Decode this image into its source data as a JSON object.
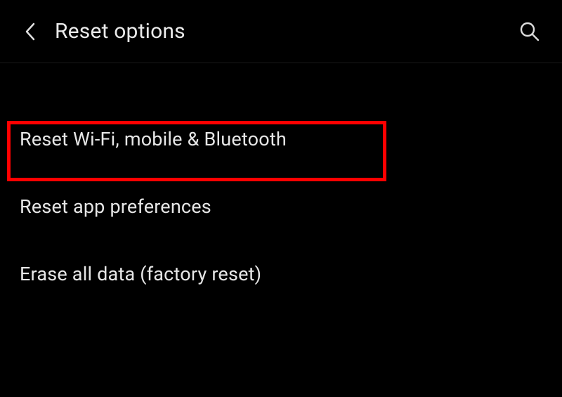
{
  "header": {
    "title": "Reset options"
  },
  "options": {
    "items": [
      {
        "label": "Reset Wi-Fi, mobile & Bluetooth"
      },
      {
        "label": "Reset app preferences"
      },
      {
        "label": "Erase all data (factory reset)"
      }
    ]
  }
}
